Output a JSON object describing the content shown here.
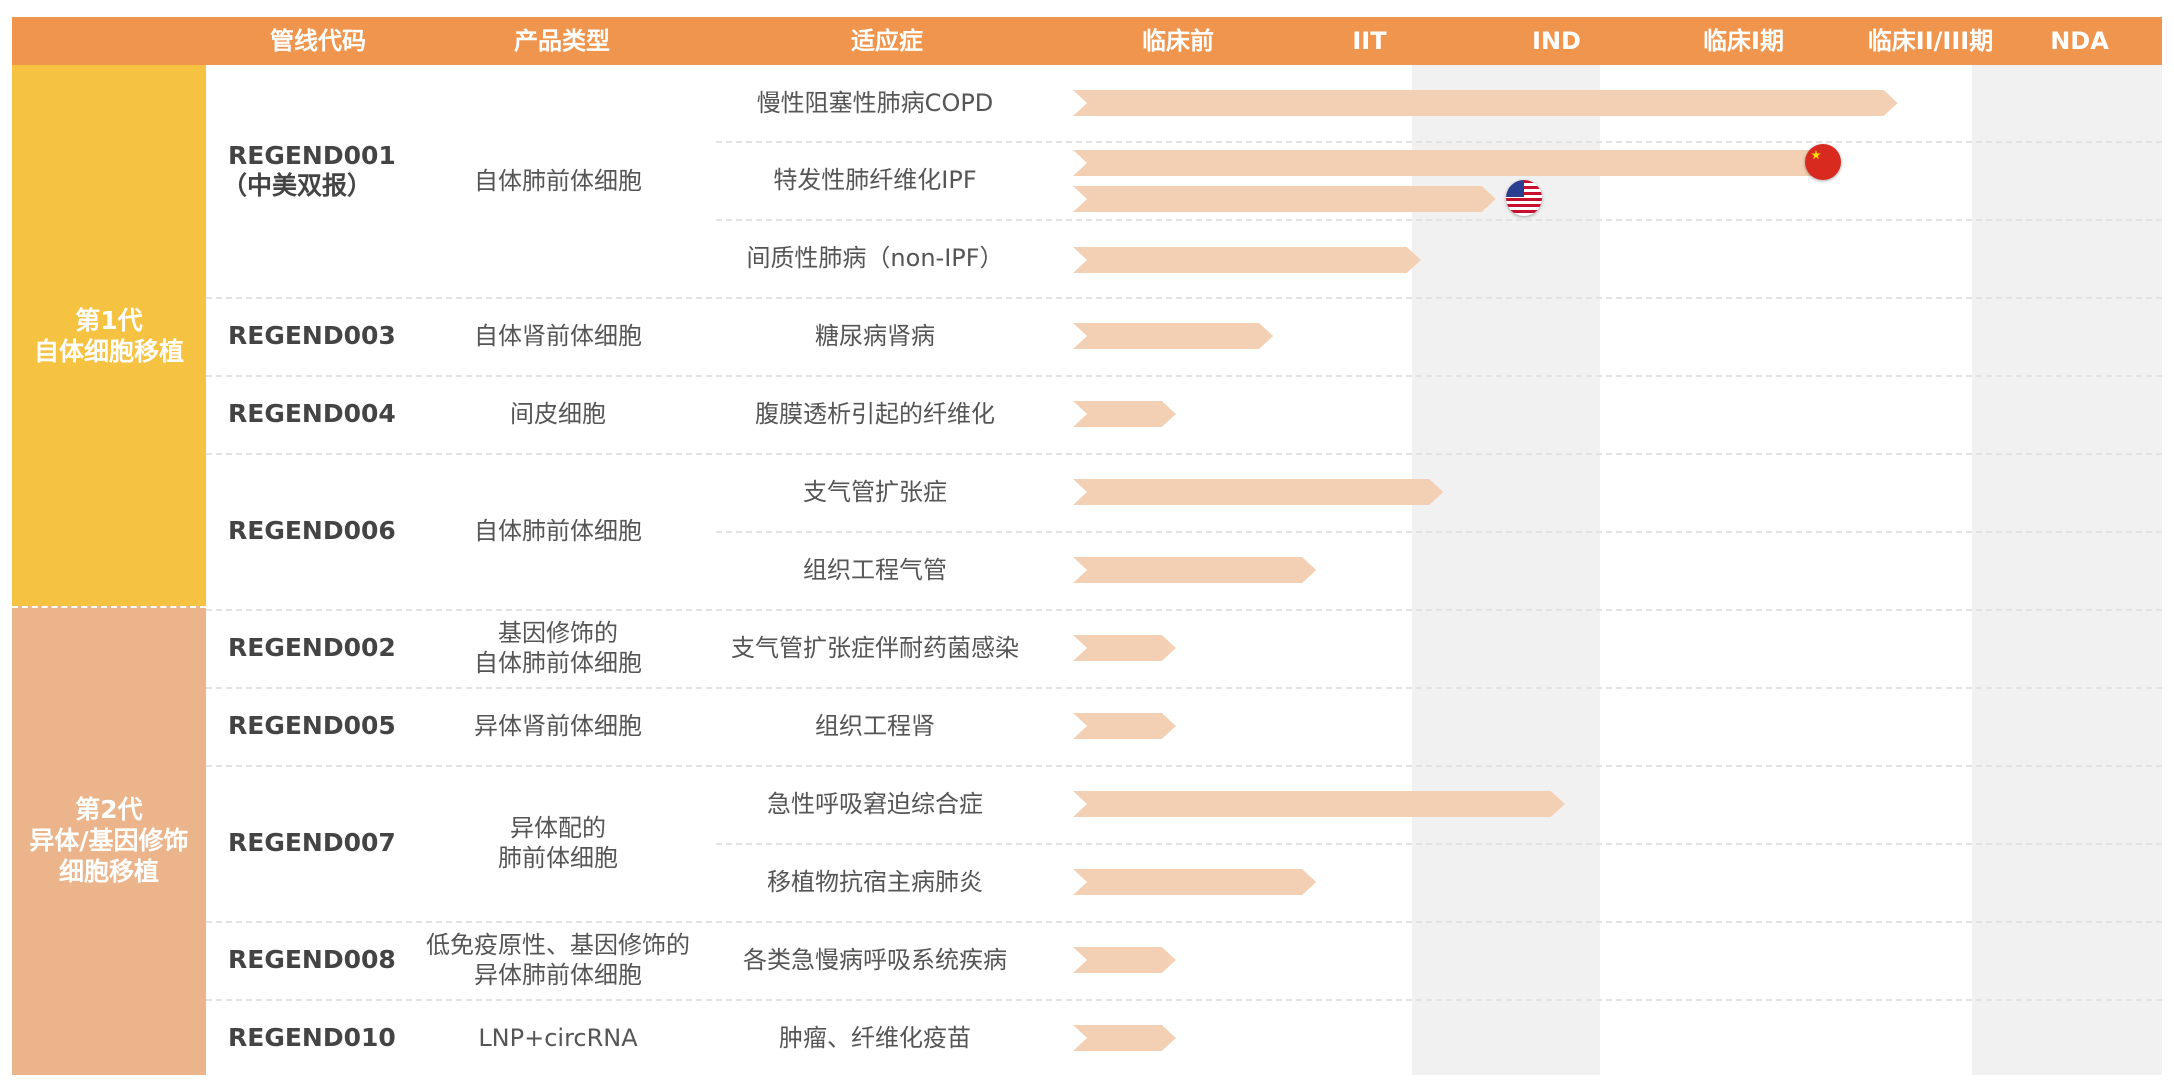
{
  "colors": {
    "header": "#f0954e",
    "gen1": "#f5c242",
    "gen2": "#ebb48a",
    "bar": "#f3cfb4",
    "shade": "#f1f1f2"
  },
  "header": {
    "code": "管线代码",
    "type": "产品类型",
    "indication": "适应症",
    "phases": [
      "临床前",
      "IIT",
      "IND",
      "临床I期",
      "临床II/III期",
      "NDA"
    ]
  },
  "generations": [
    {
      "line1": "第1代",
      "line2": "自体细胞移植"
    },
    {
      "line1": "第2代",
      "line2": "异体/基因修饰",
      "line3": "细胞移植"
    }
  ],
  "pipelines": [
    {
      "code": "REGEND001",
      "code_note": "（中美双报）",
      "type": "自体肺前体细胞"
    },
    {
      "code": "REGEND003",
      "type": "自体肾前体细胞"
    },
    {
      "code": "REGEND004",
      "type": "间皮细胞"
    },
    {
      "code": "REGEND006",
      "type": "自体肺前体细胞"
    },
    {
      "code": "REGEND002",
      "type_line1": "基因修饰的",
      "type_line2": "自体肺前体细胞"
    },
    {
      "code": "REGEND005",
      "type": "异体肾前体细胞"
    },
    {
      "code": "REGEND007",
      "type_line1": "异体配的",
      "type_line2": "肺前体细胞"
    },
    {
      "code": "REGEND008",
      "type_line1": "低免疫原性、基因修饰的",
      "type_line2": "异体肺前体细胞"
    },
    {
      "code": "REGEND010",
      "type": "LNP+circRNA"
    }
  ],
  "chart_data": {
    "type": "bar",
    "phases": [
      "临床前",
      "IIT",
      "IND",
      "临床I期",
      "临床II/III期",
      "NDA"
    ],
    "value_unit": "progress in phase columns from start of 临床前",
    "rows": [
      {
        "code": "REGEND001",
        "indication": "慢性阻塞性肺病COPD",
        "progress": 4.41
      },
      {
        "code": "REGEND001",
        "indication": "特发性肺纤维化IPF",
        "progress": 4.1,
        "flag": "china"
      },
      {
        "code": "REGEND001",
        "indication": "特发性肺纤维化IPF",
        "progress": 2.26,
        "flag": "usa"
      },
      {
        "code": "REGEND001",
        "indication": "间质性肺病（non-IPF）",
        "progress": 1.86
      },
      {
        "code": "REGEND003",
        "indication": "糖尿病肾病",
        "progress": 1.07
      },
      {
        "code": "REGEND004",
        "indication": "腹膜透析引起的纤维化",
        "progress": 0.55
      },
      {
        "code": "REGEND006",
        "indication": "支气管扩张症",
        "progress": 1.98
      },
      {
        "code": "REGEND006",
        "indication": "组织工程气管",
        "progress": 1.3
      },
      {
        "code": "REGEND002",
        "indication": "支气管扩张症伴耐药菌感染",
        "progress": 0.55
      },
      {
        "code": "REGEND005",
        "indication": "组织工程肾",
        "progress": 0.55
      },
      {
        "code": "REGEND007",
        "indication": "急性呼吸窘迫综合症",
        "progress": 2.63
      },
      {
        "code": "REGEND007",
        "indication": "移植物抗宿主病肺炎",
        "progress": 1.3
      },
      {
        "code": "REGEND008",
        "indication": "各类急慢病呼吸系统疾病",
        "progress": 0.55
      },
      {
        "code": "REGEND010",
        "indication": "肿瘤、纤维化疫苗",
        "progress": 0.55
      }
    ]
  }
}
